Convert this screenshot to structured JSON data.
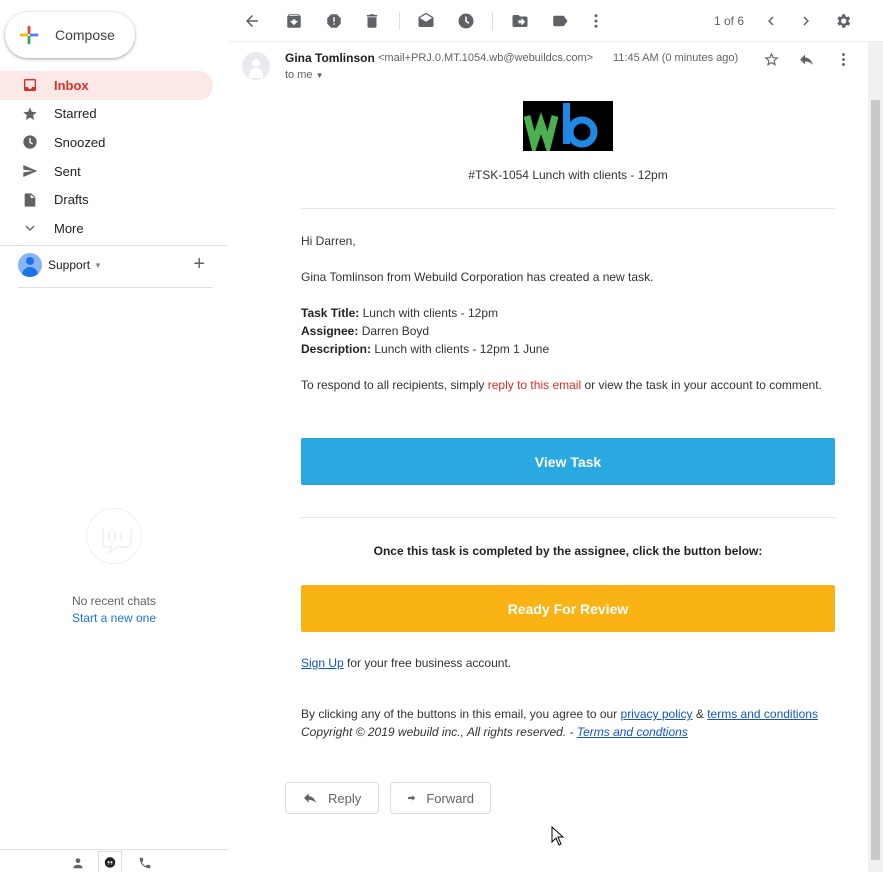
{
  "sidebar": {
    "compose_label": "Compose",
    "items": [
      {
        "label": "Inbox",
        "icon": "inbox-icon",
        "active": true
      },
      {
        "label": "Starred",
        "icon": "star-icon"
      },
      {
        "label": "Snoozed",
        "icon": "clock-icon"
      },
      {
        "label": "Sent",
        "icon": "send-icon"
      },
      {
        "label": "Drafts",
        "icon": "draft-icon"
      },
      {
        "label": "More",
        "icon": "chevron-down-icon"
      }
    ],
    "chat_account": "Support",
    "chat_empty_text": "No recent chats",
    "chat_start_link": "Start a new one"
  },
  "toolbar": {
    "pager": "1 of 6"
  },
  "email": {
    "sender_name": "Gina Tomlinson",
    "sender_email": "<mail+PRJ.0.MT.1054.wb@webuildcs.com>",
    "to": "to me",
    "time": "11:45 AM (0 minutes ago)",
    "subject_line": "#TSK-1054 Lunch with clients - 12pm",
    "greeting": "Hi Darren,",
    "intro": "Gina Tomlinson from Webuild Corporation has created a new task.",
    "task_title_label": "Task Title:",
    "task_title": "Lunch with clients - 12pm",
    "assignee_label": "Assignee:",
    "assignee": "Darren Boyd",
    "description_label": "Description:",
    "description": "Lunch with clients - 12pm 1 June",
    "respond_pre": "To respond to all recipients, simply ",
    "respond_link": "reply to this email",
    "respond_post": " or view the task in your account to comment.",
    "view_task_button": "View Task",
    "completed_text": "Once this task is completed by the assignee, click the button below:",
    "review_button": "Ready For Review",
    "signup_link": "Sign Up",
    "signup_text": " for your free business account.",
    "legal_pre": "By clicking any of the buttons in this email, you agree to our ",
    "privacy_link": "privacy policy",
    "legal_amp": " & ",
    "terms_link": "terms and conditions",
    "copyright": "Copyright © 2019 webuild inc., All rights reserved. - ",
    "terms_link2": "Terms and condtions",
    "reply_label": "Reply",
    "forward_label": "Forward"
  },
  "colors": {
    "inbox_active_bg": "#fce8e6",
    "inbox_active_text": "#d93025",
    "view_task_bg": "#2aa8e0",
    "review_bg": "#f9b314",
    "link": "#1155cc",
    "logo_green": "#4caf50",
    "logo_blue": "#1e88e5"
  }
}
